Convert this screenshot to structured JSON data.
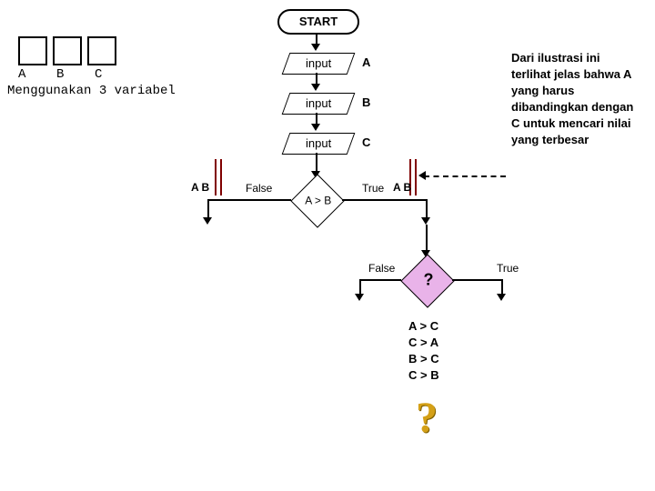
{
  "start": "START",
  "inputs": {
    "label": "input",
    "a": "A",
    "b": "B",
    "c": "C"
  },
  "topLeft": {
    "vars": "A    B    C",
    "caption": "Menggunakan 3 variabel"
  },
  "decision1": {
    "label": "A > B",
    "falseLabel": "False",
    "trueLabel": "True",
    "leftMark": "A B",
    "rightMark": "A B"
  },
  "decision2": {
    "symbol": "?",
    "falseLabel": "False",
    "trueLabel": "True"
  },
  "compareList": [
    "A > C",
    "C > A",
    "B > C",
    "C > B"
  ],
  "bigQ": "?",
  "note": "Dari ilustrasi ini terlihat jelas bahwa  A yang harus dibandingkan dengan C untuk mencari nilai yang terbesar"
}
